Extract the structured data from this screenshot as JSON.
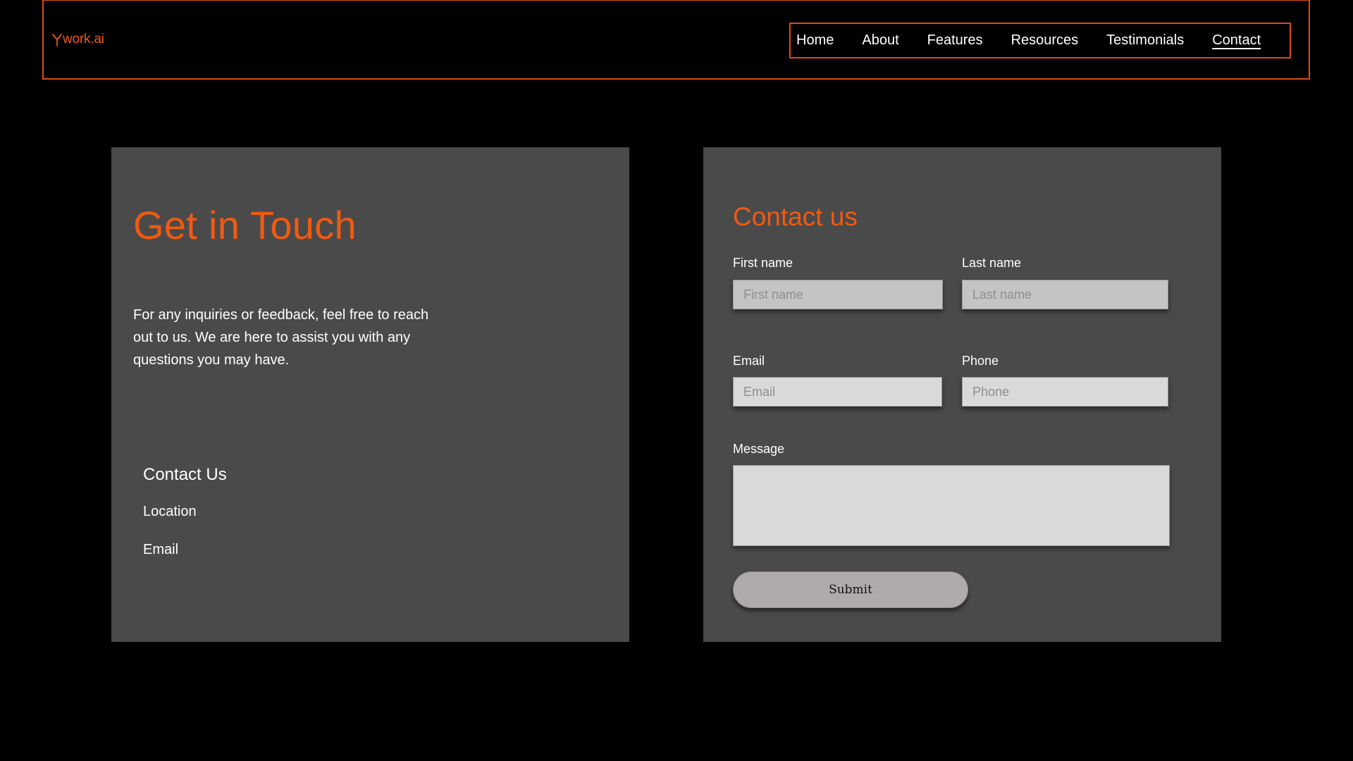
{
  "header": {
    "logo_text": "work.ai",
    "logo_icon": "logo-mark-icon",
    "nav": [
      {
        "label": "Home"
      },
      {
        "label": "About"
      },
      {
        "label": "Features"
      },
      {
        "label": "Resources"
      },
      {
        "label": "Testimonials"
      },
      {
        "label": "Contact",
        "active": true
      }
    ]
  },
  "left_card": {
    "title": "Get in Touch",
    "intro": "For any inquiries or feedback, feel free to reach out to us. We are here to assist you with any questions you may have.",
    "contact_heading": "Contact Us",
    "location_label": "Location",
    "email_label": "Email"
  },
  "form": {
    "title": "Contact us",
    "first_name": {
      "label": "First name",
      "placeholder": "First name",
      "value": ""
    },
    "last_name": {
      "label": "Last name",
      "placeholder": "Last name",
      "value": ""
    },
    "email": {
      "label": "Email",
      "placeholder": "Email",
      "value": ""
    },
    "phone": {
      "label": "Phone",
      "placeholder": "Phone",
      "value": ""
    },
    "message": {
      "label": "Message",
      "value": ""
    },
    "submit_label": "Submit"
  },
  "colors": {
    "accent": "#f05a12",
    "border_accent": "#d94d14",
    "card_bg": "#4a4a4a",
    "page_bg": "#000000",
    "input_bg": "#c4c4c4",
    "button_bg": "#b0abab"
  }
}
